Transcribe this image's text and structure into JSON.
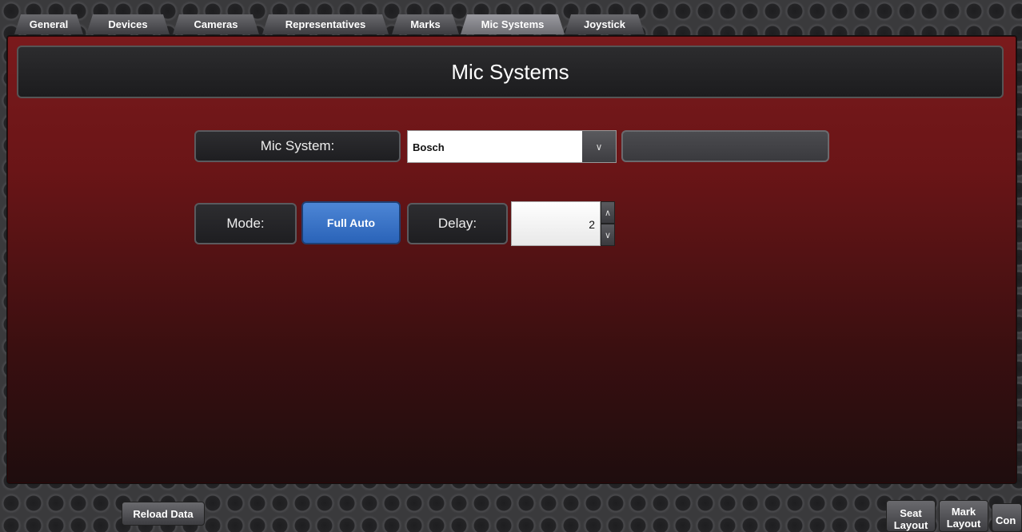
{
  "tabs": [
    {
      "label": "General",
      "active": false
    },
    {
      "label": "Devices",
      "active": false
    },
    {
      "label": "Cameras",
      "active": false
    },
    {
      "label": "Representatives",
      "active": false
    },
    {
      "label": "Marks",
      "active": false
    },
    {
      "label": "Mic Systems",
      "active": true
    },
    {
      "label": "Joystick",
      "active": false
    }
  ],
  "page": {
    "title": "Mic Systems"
  },
  "mic_system": {
    "label": "Mic System:",
    "selected": "Bosch",
    "dropdown_icon": "chevron-down-icon"
  },
  "mode": {
    "label": "Mode:",
    "value": "Full Auto"
  },
  "delay": {
    "label": "Delay:",
    "value": "2"
  },
  "bottom": {
    "reload_label": "Reload Data",
    "seat_label": "Seat",
    "seat_sub": "Layout",
    "mark_label": "Mark",
    "mark_sub": "Layout",
    "con_label": "Con"
  },
  "colors": {
    "accent_blue": "#3a74c8",
    "panel_red": "#7a1a1c",
    "chrome_gray": "#4a4a4e"
  }
}
